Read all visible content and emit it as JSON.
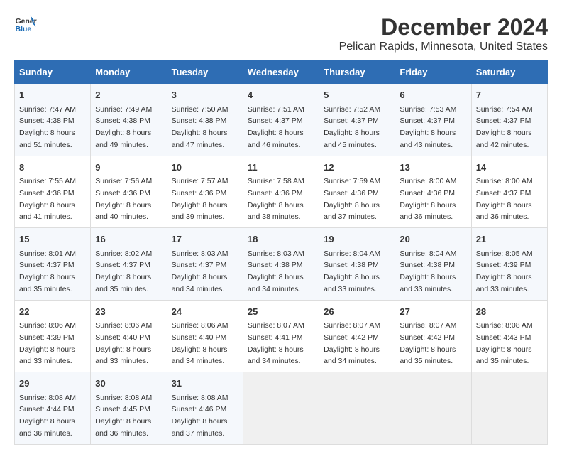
{
  "logo": {
    "line1": "General",
    "line2": "Blue"
  },
  "title": "December 2024",
  "subtitle": "Pelican Rapids, Minnesota, United States",
  "days_header": [
    "Sunday",
    "Monday",
    "Tuesday",
    "Wednesday",
    "Thursday",
    "Friday",
    "Saturday"
  ],
  "weeks": [
    [
      {
        "day": "1",
        "lines": [
          "Sunrise: 7:47 AM",
          "Sunset: 4:38 PM",
          "Daylight: 8 hours",
          "and 51 minutes."
        ]
      },
      {
        "day": "2",
        "lines": [
          "Sunrise: 7:49 AM",
          "Sunset: 4:38 PM",
          "Daylight: 8 hours",
          "and 49 minutes."
        ]
      },
      {
        "day": "3",
        "lines": [
          "Sunrise: 7:50 AM",
          "Sunset: 4:38 PM",
          "Daylight: 8 hours",
          "and 47 minutes."
        ]
      },
      {
        "day": "4",
        "lines": [
          "Sunrise: 7:51 AM",
          "Sunset: 4:37 PM",
          "Daylight: 8 hours",
          "and 46 minutes."
        ]
      },
      {
        "day": "5",
        "lines": [
          "Sunrise: 7:52 AM",
          "Sunset: 4:37 PM",
          "Daylight: 8 hours",
          "and 45 minutes."
        ]
      },
      {
        "day": "6",
        "lines": [
          "Sunrise: 7:53 AM",
          "Sunset: 4:37 PM",
          "Daylight: 8 hours",
          "and 43 minutes."
        ]
      },
      {
        "day": "7",
        "lines": [
          "Sunrise: 7:54 AM",
          "Sunset: 4:37 PM",
          "Daylight: 8 hours",
          "and 42 minutes."
        ]
      }
    ],
    [
      {
        "day": "8",
        "lines": [
          "Sunrise: 7:55 AM",
          "Sunset: 4:36 PM",
          "Daylight: 8 hours",
          "and 41 minutes."
        ]
      },
      {
        "day": "9",
        "lines": [
          "Sunrise: 7:56 AM",
          "Sunset: 4:36 PM",
          "Daylight: 8 hours",
          "and 40 minutes."
        ]
      },
      {
        "day": "10",
        "lines": [
          "Sunrise: 7:57 AM",
          "Sunset: 4:36 PM",
          "Daylight: 8 hours",
          "and 39 minutes."
        ]
      },
      {
        "day": "11",
        "lines": [
          "Sunrise: 7:58 AM",
          "Sunset: 4:36 PM",
          "Daylight: 8 hours",
          "and 38 minutes."
        ]
      },
      {
        "day": "12",
        "lines": [
          "Sunrise: 7:59 AM",
          "Sunset: 4:36 PM",
          "Daylight: 8 hours",
          "and 37 minutes."
        ]
      },
      {
        "day": "13",
        "lines": [
          "Sunrise: 8:00 AM",
          "Sunset: 4:36 PM",
          "Daylight: 8 hours",
          "and 36 minutes."
        ]
      },
      {
        "day": "14",
        "lines": [
          "Sunrise: 8:00 AM",
          "Sunset: 4:37 PM",
          "Daylight: 8 hours",
          "and 36 minutes."
        ]
      }
    ],
    [
      {
        "day": "15",
        "lines": [
          "Sunrise: 8:01 AM",
          "Sunset: 4:37 PM",
          "Daylight: 8 hours",
          "and 35 minutes."
        ]
      },
      {
        "day": "16",
        "lines": [
          "Sunrise: 8:02 AM",
          "Sunset: 4:37 PM",
          "Daylight: 8 hours",
          "and 35 minutes."
        ]
      },
      {
        "day": "17",
        "lines": [
          "Sunrise: 8:03 AM",
          "Sunset: 4:37 PM",
          "Daylight: 8 hours",
          "and 34 minutes."
        ]
      },
      {
        "day": "18",
        "lines": [
          "Sunrise: 8:03 AM",
          "Sunset: 4:38 PM",
          "Daylight: 8 hours",
          "and 34 minutes."
        ]
      },
      {
        "day": "19",
        "lines": [
          "Sunrise: 8:04 AM",
          "Sunset: 4:38 PM",
          "Daylight: 8 hours",
          "and 33 minutes."
        ]
      },
      {
        "day": "20",
        "lines": [
          "Sunrise: 8:04 AM",
          "Sunset: 4:38 PM",
          "Daylight: 8 hours",
          "and 33 minutes."
        ]
      },
      {
        "day": "21",
        "lines": [
          "Sunrise: 8:05 AM",
          "Sunset: 4:39 PM",
          "Daylight: 8 hours",
          "and 33 minutes."
        ]
      }
    ],
    [
      {
        "day": "22",
        "lines": [
          "Sunrise: 8:06 AM",
          "Sunset: 4:39 PM",
          "Daylight: 8 hours",
          "and 33 minutes."
        ]
      },
      {
        "day": "23",
        "lines": [
          "Sunrise: 8:06 AM",
          "Sunset: 4:40 PM",
          "Daylight: 8 hours",
          "and 33 minutes."
        ]
      },
      {
        "day": "24",
        "lines": [
          "Sunrise: 8:06 AM",
          "Sunset: 4:40 PM",
          "Daylight: 8 hours",
          "and 34 minutes."
        ]
      },
      {
        "day": "25",
        "lines": [
          "Sunrise: 8:07 AM",
          "Sunset: 4:41 PM",
          "Daylight: 8 hours",
          "and 34 minutes."
        ]
      },
      {
        "day": "26",
        "lines": [
          "Sunrise: 8:07 AM",
          "Sunset: 4:42 PM",
          "Daylight: 8 hours",
          "and 34 minutes."
        ]
      },
      {
        "day": "27",
        "lines": [
          "Sunrise: 8:07 AM",
          "Sunset: 4:42 PM",
          "Daylight: 8 hours",
          "and 35 minutes."
        ]
      },
      {
        "day": "28",
        "lines": [
          "Sunrise: 8:08 AM",
          "Sunset: 4:43 PM",
          "Daylight: 8 hours",
          "and 35 minutes."
        ]
      }
    ],
    [
      {
        "day": "29",
        "lines": [
          "Sunrise: 8:08 AM",
          "Sunset: 4:44 PM",
          "Daylight: 8 hours",
          "and 36 minutes."
        ]
      },
      {
        "day": "30",
        "lines": [
          "Sunrise: 8:08 AM",
          "Sunset: 4:45 PM",
          "Daylight: 8 hours",
          "and 36 minutes."
        ]
      },
      {
        "day": "31",
        "lines": [
          "Sunrise: 8:08 AM",
          "Sunset: 4:46 PM",
          "Daylight: 8 hours",
          "and 37 minutes."
        ]
      },
      null,
      null,
      null,
      null
    ]
  ]
}
